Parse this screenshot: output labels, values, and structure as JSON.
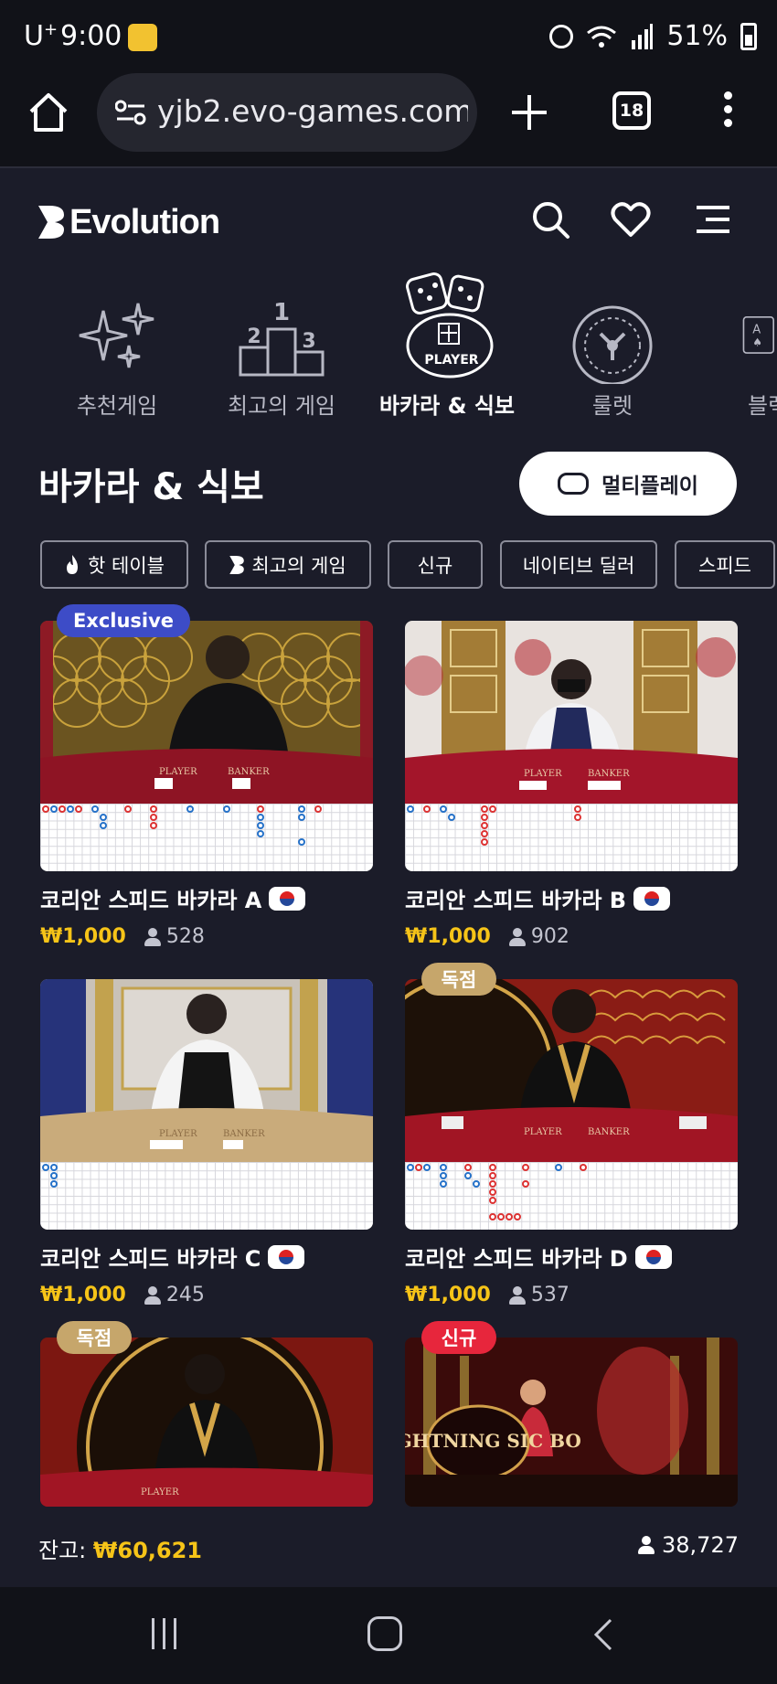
{
  "status_bar": {
    "carrier": "U",
    "carrier_sup": "+",
    "time": "9:00",
    "battery": "51%"
  },
  "browser": {
    "url": "yjb2.evo-games.com",
    "tab_count": "18"
  },
  "site": {
    "logo_text": "Evolution"
  },
  "categories": [
    {
      "label": "추천게임",
      "icon": "sparkles-icon"
    },
    {
      "label": "최고의 게임",
      "icon": "podium-icon"
    },
    {
      "label": "바카라 & 식보",
      "icon": "dice-player-icon",
      "active": true
    },
    {
      "label": "룰렛",
      "icon": "roulette-icon"
    },
    {
      "label": "블랙",
      "icon": "cards-icon"
    }
  ],
  "section": {
    "title": "바카라 & 식보",
    "multiplay_label": "멀티플레이"
  },
  "chips": [
    {
      "label": "핫 테이블",
      "icon": "flame-icon"
    },
    {
      "label": "최고의 게임",
      "icon": "evolution-mark-icon"
    },
    {
      "label": "신규"
    },
    {
      "label": "네이티브 딜러"
    },
    {
      "label": "스피드"
    }
  ],
  "games": [
    {
      "title": "코리안 스피드 바카라 A",
      "price": "₩1,000",
      "players": "528",
      "badge": "Exclusive"
    },
    {
      "title": "코리안 스피드 바카라 B",
      "price": "₩1,000",
      "players": "902",
      "badge": ""
    },
    {
      "title": "코리안 스피드 바카라 C",
      "price": "₩1,000",
      "players": "245",
      "badge": ""
    },
    {
      "title": "코리안 스피드 바카라 D",
      "price": "₩1,000",
      "players": "537",
      "badge": "독점"
    },
    {
      "title": "",
      "price": "",
      "players": "",
      "badge": "독점"
    },
    {
      "title": "",
      "price": "",
      "players": "",
      "badge": "신규",
      "thumb_text": "LIGHTNING SIC BO"
    }
  ],
  "table_labels": {
    "player": "PLAYER",
    "banker": "BANKER"
  },
  "footer": {
    "balance_label": "잔고:",
    "balance_value": "₩60,621",
    "total_players": "38,727"
  },
  "colors": {
    "background": "#1b1c29",
    "accent_gold": "#f6c418",
    "exclusive_blue": "#3d4cc7",
    "new_red": "#e7263c",
    "exclusive_gold": "#c6a66b"
  }
}
